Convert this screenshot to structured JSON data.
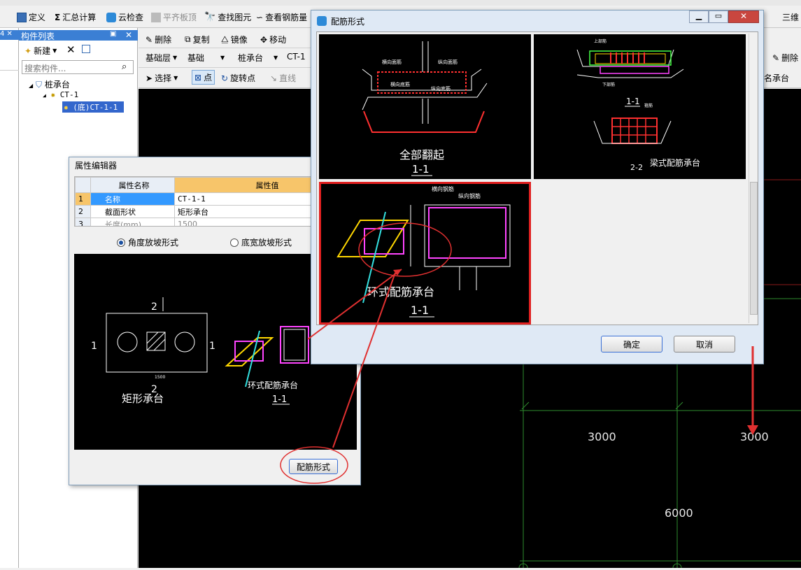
{
  "toolbar1": {
    "define": "定义",
    "sum": "汇总计算",
    "cloud_check": "云检查",
    "flat_top": "平齐板顶",
    "find": "查找图元",
    "view_rebar": "查看钢筋量",
    "three_d": "三维"
  },
  "component_list": {
    "title": "构件列表",
    "new": "新建",
    "search_placeholder": "搜索构件...",
    "tree": [
      "桩承台",
      "CT-1",
      "(底)CT-1-1"
    ]
  },
  "toolbar2": {
    "delete": "删除",
    "copy": "复制",
    "mirror": "镜像",
    "move": "移动",
    "delete_right": "删除"
  },
  "toolbar3": {
    "layer": "基础层",
    "layer_type": "基础",
    "comp_type": "桩承台",
    "comp": "CT-1"
  },
  "toolbar4": {
    "select": "选择",
    "point": "点",
    "rotate_point": "旋转点",
    "line": "直线",
    "name_right": "名承台"
  },
  "canvas_dims": [
    "3000",
    "3000",
    "6000"
  ],
  "property_editor": {
    "title": "属性编辑器",
    "col_name": "属性名称",
    "col_value": "属性值",
    "rows": [
      {
        "no": "1",
        "name": "名称",
        "value": "CT-1-1"
      },
      {
        "no": "2",
        "name": "截面形状",
        "value": "矩形承台"
      },
      {
        "no": "3",
        "name": "长度(mm)",
        "value": "1500"
      }
    ],
    "radio_angle": "角度放坡形式",
    "radio_bottom": "底宽放坡形式",
    "rebar_button": "配筋形式",
    "preview": {
      "label_2": "2",
      "label_1": "1",
      "dim_1500": "1500",
      "rect_title": "矩形承台",
      "ring_title": "环式配筋承台",
      "ring_section": "1-1"
    }
  },
  "rebar_dialog": {
    "title": "配筋形式",
    "options": [
      {
        "title": "全部翻起",
        "section": "1-1"
      },
      {
        "title": "梁式配筋承台",
        "section": "1-1",
        "section2": "2-2"
      },
      {
        "title": "环式配筋承台",
        "section": "1-1",
        "selected": true
      }
    ],
    "cad_labels": {
      "horizontal_top": "横向面筋",
      "vertical_top": "纵向面筋",
      "horizontal_bottom": "横向底筋",
      "vertical_bottom": "纵向底筋",
      "horizontal_rebar": "横向钢筋",
      "vertical_rebar": "纵向钢筋",
      "top_rebar": "上部筋",
      "bottom_rebar": "下部筋",
      "stirrup": "箍筋"
    },
    "ok": "确定",
    "cancel": "取消"
  }
}
